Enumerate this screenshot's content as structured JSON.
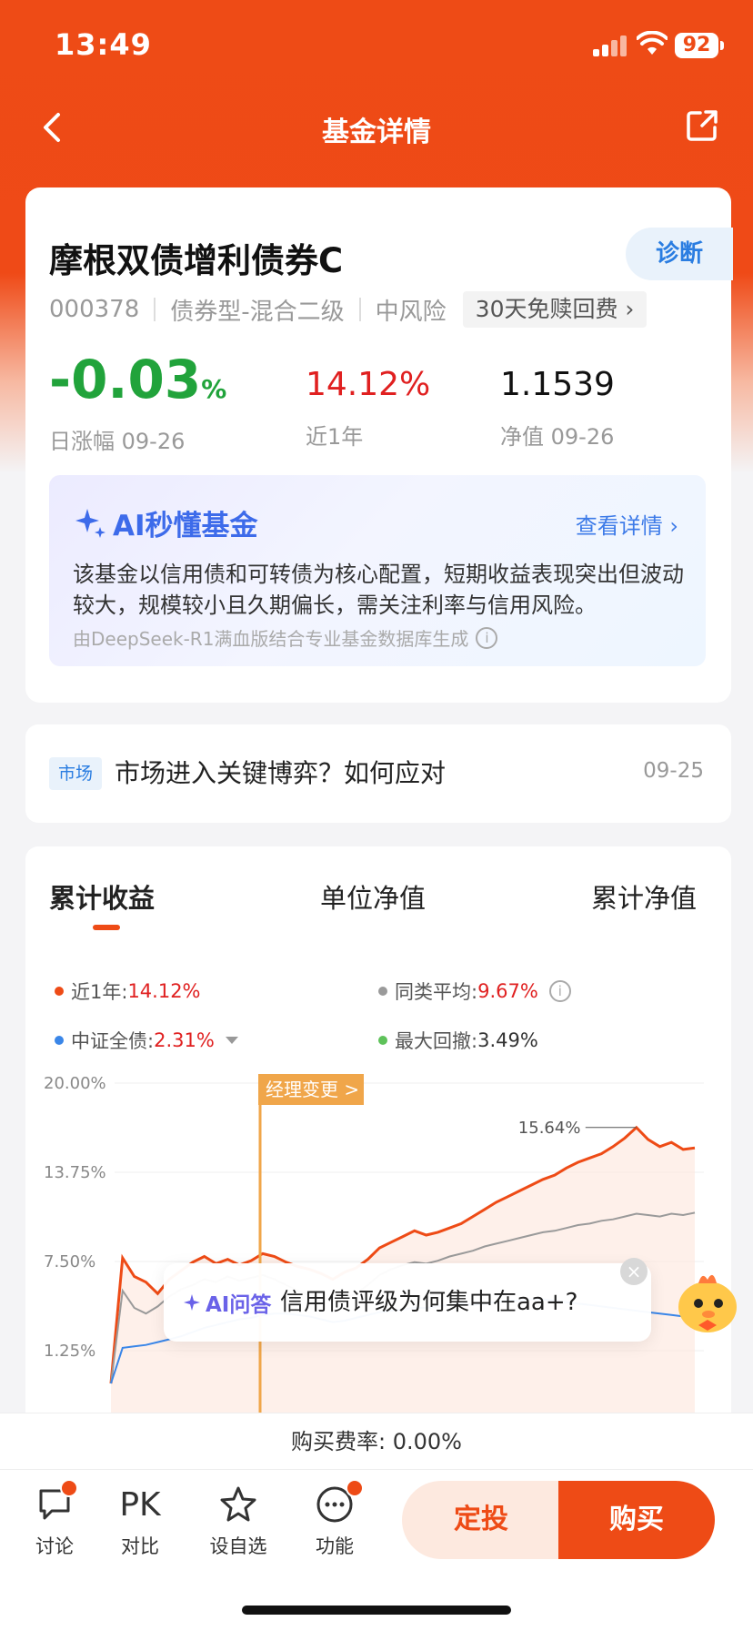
{
  "status_bar": {
    "time": "13:49",
    "battery": "92"
  },
  "nav": {
    "title": "基金详情"
  },
  "fund": {
    "name": "摩根双债增利债券C",
    "diagnose_label": "诊断",
    "code": "000378",
    "type": "债券型-混合二级",
    "risk": "中风险",
    "fee_badge": "30天免赎回费 ›",
    "daily_change": "-0.03",
    "daily_change_unit": "%",
    "daily_change_label": "日涨幅 09-26",
    "year_return": "14.12%",
    "year_return_label": "近1年",
    "nav_value": "1.1539",
    "nav_label": "净值 09-26"
  },
  "ai_summary": {
    "title": "AI秒懂基金",
    "detail_link": "查看详情 ›",
    "text": "该基金以信用债和可转债为核心配置，短期收益表现突出但波动较大，规模较小且久期偏长，需关注利率与信用风险。",
    "source": "由DeepSeek-R1满血版结合专业基金数据库生成"
  },
  "news": {
    "tag": "市场",
    "title": "市场进入关键博弈？如何应对",
    "date": "09-25"
  },
  "chart_tabs": [
    "累计收益",
    "单位净值",
    "累计净值"
  ],
  "legend": {
    "fund_label": "近1年:",
    "fund_value": "14.12%",
    "peer_label": "同类平均:",
    "peer_value": "9.67%",
    "index_label": "中证全债:",
    "index_value": "2.31%",
    "drawdown_label": "最大回撤:",
    "drawdown_value": "3.49%"
  },
  "chart_data": {
    "type": "line",
    "y_ticks": [
      "20.00%",
      "13.75%",
      "7.50%",
      "1.25%"
    ],
    "ylim": [
      1.25,
      20.0
    ],
    "annotation_manager": "经理变更 >",
    "annotation_peak": "15.64%",
    "series": [
      {
        "name": "近1年",
        "color": "#ee4b16",
        "values": [
          0.0,
          6.5,
          5.2,
          4.8,
          4.0,
          5.0,
          5.6,
          6.2,
          6.6,
          6.1,
          6.4,
          6.0,
          6.3,
          6.8,
          6.6,
          6.2,
          5.9,
          5.7,
          5.4,
          5.0,
          5.5,
          5.8,
          6.4,
          7.2,
          7.6,
          8.0,
          8.4,
          8.1,
          8.3,
          8.6,
          8.9,
          9.4,
          9.9,
          10.4,
          10.8,
          11.2,
          11.6,
          12.0,
          12.3,
          12.8,
          13.2,
          13.5,
          13.8,
          14.3,
          14.9,
          15.64,
          14.8,
          14.3,
          14.6,
          14.1,
          14.2
        ]
      },
      {
        "name": "同类平均",
        "color": "#9a9a9a",
        "values": [
          0.0,
          4.2,
          3.0,
          2.6,
          3.1,
          3.8,
          4.3,
          4.6,
          5.0,
          4.8,
          5.2,
          4.9,
          5.1,
          5.3,
          5.0,
          4.6,
          4.2,
          3.9,
          3.7,
          3.5,
          3.7,
          4.0,
          4.6,
          5.3,
          5.7,
          6.0,
          6.2,
          6.1,
          6.3,
          6.6,
          6.8,
          7.0,
          7.3,
          7.5,
          7.7,
          7.9,
          8.1,
          8.3,
          8.4,
          8.6,
          8.8,
          8.9,
          9.1,
          9.2,
          9.4,
          9.6,
          9.5,
          9.4,
          9.6,
          9.5,
          9.67
        ]
      },
      {
        "name": "中证全债",
        "color": "#3a86e8",
        "values": [
          0.0,
          0.2,
          0.3,
          0.4,
          0.6,
          0.8,
          1.0,
          1.3,
          1.6,
          1.8,
          2.0,
          2.2,
          2.3,
          2.5,
          2.6,
          2.6,
          2.5,
          2.4,
          2.2,
          2.0,
          2.1,
          2.3,
          2.5,
          2.7,
          2.8,
          2.9,
          3.0,
          3.0,
          3.1,
          3.2,
          3.3,
          3.2,
          3.3,
          3.4,
          3.5,
          3.5,
          3.6,
          3.6,
          3.5,
          3.4,
          3.3,
          3.2,
          3.1,
          3.0,
          2.9,
          2.8,
          2.7,
          2.6,
          2.5,
          2.4,
          2.31
        ]
      }
    ]
  },
  "qa": {
    "label": "AI问答",
    "question": "信用债评级为何集中在aa+?"
  },
  "fee_row": "购买费率: 0.00%",
  "bottom_bar": {
    "discuss": "讨论",
    "pk": "PK",
    "compare": "对比",
    "watchlist": "设自选",
    "functions": "功能",
    "dingtou": "定投",
    "buy": "购买"
  }
}
